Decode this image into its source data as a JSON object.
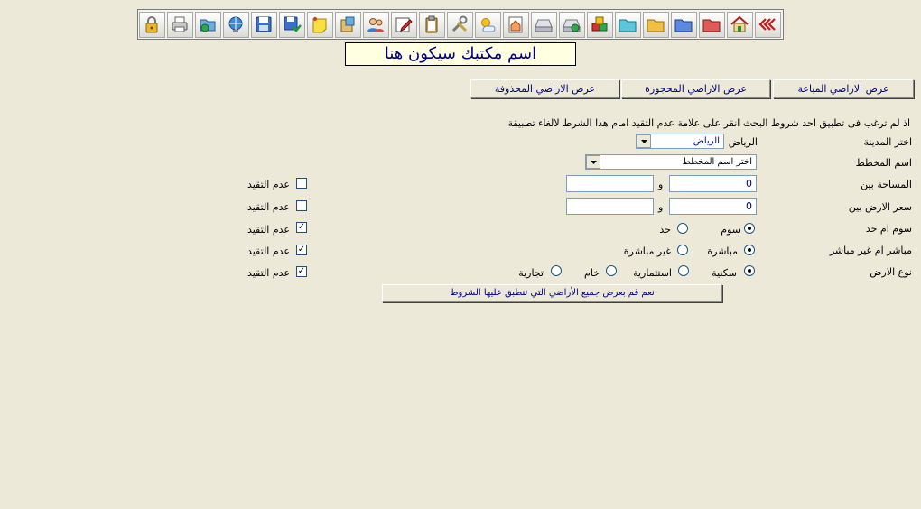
{
  "toolbar": {
    "icons": [
      "lock-icon",
      "printer-icon",
      "folder-sync-icon",
      "network-globe-icon",
      "save-icon",
      "save-green-icon",
      "note-icon",
      "transfer-icon",
      "users-icon",
      "edit-icon",
      "clipboard-icon",
      "tools-icon",
      "weather-icon",
      "house-doc-icon",
      "drive-icon",
      "drive-green-icon",
      "cubes-icon",
      "folder-cyan-icon",
      "folder-yellow-icon",
      "folder-blue-icon",
      "folder-red-icon",
      "home-icon",
      "back-arrows-icon"
    ]
  },
  "office_name": "اسم مكتبك سيكون هنا",
  "nav": {
    "sold": "عرض الاراضي المباعة",
    "reserved": "عرض الاراضي المحجوزة",
    "deleted": "عرض الاراضي المحذوفة"
  },
  "instructions": "اذ لم ترغب فى تطبيق احد شروط البحث انقر على علامة عدم التقيد امام هذا الشرط لالغاء تطبيقة",
  "form": {
    "city_label": "اختر المدينة",
    "city_prefix": "الرياض",
    "city_value": "الرياض",
    "plan_label": "اسم المخطط",
    "plan_value": "اختر اسم المخطط",
    "area_label": "المساحة  بين",
    "area_from": "0",
    "area_to": "",
    "and": "و",
    "price_label": "سعر الارض بين",
    "price_from": "0",
    "price_to": "",
    "bid_label": "سوم ام حد",
    "bid_opt1": "سوم",
    "bid_opt2": "حد",
    "direct_label": "مباشر ام غير مباشر",
    "direct_opt1": "مباشرة",
    "direct_opt2": "غير مباشرة",
    "type_label": "نوع الارض",
    "type_opt1": "سكنية",
    "type_opt2": "استثمارية",
    "type_opt3": "خام",
    "type_opt4": "تجارية",
    "no_restrict": "عدم التقيد",
    "check_mark": "✓",
    "submit": "نعم قم بعرض جميع الأراضي التي تنطبق عليها الشروط"
  }
}
